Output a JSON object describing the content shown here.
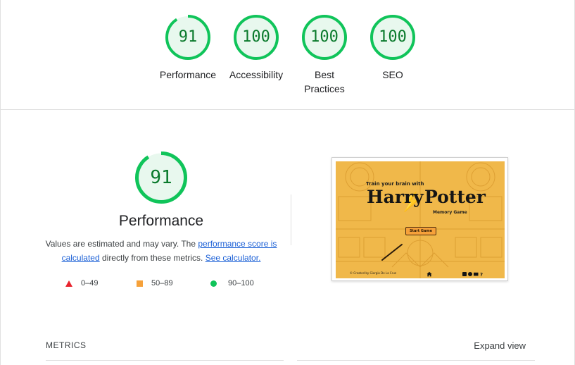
{
  "summary": {
    "gauges": [
      {
        "score": "91",
        "label": "Performance",
        "fraction": 0.91
      },
      {
        "score": "100",
        "label": "Accessibility",
        "fraction": 1.0
      },
      {
        "score": "100",
        "label": "Best Practices",
        "label_lines": [
          "Best",
          "Practices"
        ],
        "fraction": 1.0
      },
      {
        "score": "100",
        "label": "SEO",
        "fraction": 1.0
      }
    ]
  },
  "performance": {
    "score": "91",
    "fraction": 0.91,
    "title": "Performance",
    "desc_before": "Values are estimated and may vary. The ",
    "link_score": "performance score is calculated",
    "desc_middle": " directly from these metrics. ",
    "link_calculator": "See calculator.",
    "legend": [
      {
        "icon": "triangle-icon",
        "range": "0–49",
        "color": "#e8242e"
      },
      {
        "icon": "square-icon",
        "range": "50–89",
        "color": "#f6a13a"
      },
      {
        "icon": "circle-icon",
        "range": "90–100",
        "color": "#10c45a"
      }
    ]
  },
  "screenshot": {
    "tagline": "Train your brain with",
    "brand_left": "Harry",
    "brand_right": "Potter",
    "subtitle": "Memory Game",
    "start_button": "Start Game",
    "footer_credit": "© Created by Giorgio De La Cruz",
    "footer_icons": [
      "home-icon",
      "linkedin-icon",
      "github-icon",
      "mail-icon",
      "help-icon"
    ]
  },
  "metrics": {
    "heading": "METRICS",
    "expand_label": "Expand view"
  },
  "colors": {
    "pass_ring": "#10c45a",
    "pass_fill": "#e8f8ee",
    "pass_text": "#0a7a2c",
    "link": "#1a5fd6"
  }
}
